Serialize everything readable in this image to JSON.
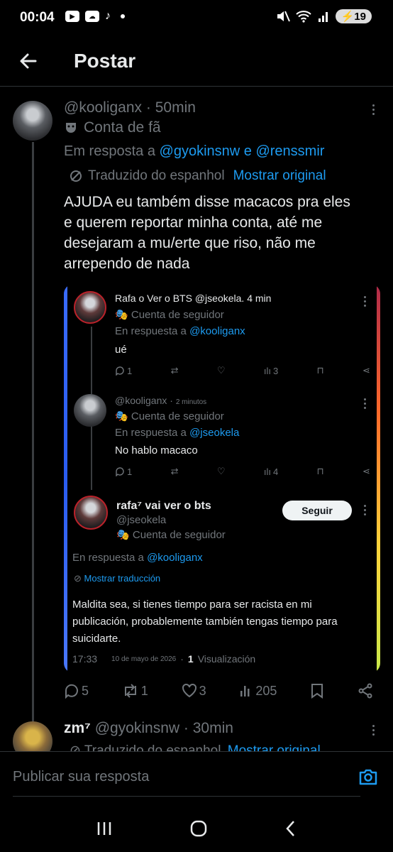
{
  "status": {
    "time": "00:04",
    "battery": "19",
    "apps": [
      "youtube",
      "sky",
      "tiktok"
    ]
  },
  "header": {
    "title": "Postar"
  },
  "post": {
    "handle": "@kooliganx",
    "time": "50min",
    "badge": "Conta de fã",
    "reply_prefix": "Em resposta a",
    "reply_user1": "@gyokinsnw",
    "reply_and": "e",
    "reply_user2": "@renssmir",
    "translated": "Traduzido do espanhol",
    "show_original": "Mostrar original",
    "text": "AJUDA eu também disse macacos pra eles e querem reportar minha conta, até me desejaram a mu/erte que riso, não me arrependo de nada",
    "actions": {
      "replies": "5",
      "reposts": "1",
      "likes": "3",
      "views": "205"
    }
  },
  "embed": {
    "tweet1": {
      "name": "Rafa o Ver o BTS",
      "handle": "@jseokela.",
      "time": "4 min",
      "badge": "Cuenta de seguidor",
      "reply_prefix": "En respuesta a",
      "reply_user": "@kooliganx",
      "text": "ué",
      "actions": {
        "replies": "1",
        "views": "3"
      }
    },
    "tweet2": {
      "handle": "@kooliganx",
      "time": "2 minutos",
      "badge": "Cuenta de seguidor",
      "reply_prefix": "En respuesta a",
      "reply_user": "@jseokela",
      "text": "No hablo macaco",
      "actions": {
        "replies": "1",
        "views": "4"
      }
    },
    "tweet3": {
      "name": "rafa⁷ vai ver o bts",
      "handle": "@jseokela",
      "badge": "Cuenta de seguidor",
      "follow": "Seguir",
      "reply_prefix": "En respuesta a",
      "reply_user": "@kooliganx",
      "show_translation": "Mostrar traducción",
      "text": "Maldita sea, si tienes tiempo para ser racista en mi publicación, probablemente también tengas tiempo para suicidarte.",
      "time": "17:33",
      "date": "10 de mayo de 2026",
      "views_count": "1",
      "views_label": "Visualización"
    }
  },
  "next_post": {
    "name": "zm⁷",
    "handle": "@gyokinsnw",
    "time": "30min",
    "translated": "Traduzido do espanhol",
    "show_original": "Mostrar original"
  },
  "reply": {
    "placeholder": "Publicar sua resposta"
  }
}
